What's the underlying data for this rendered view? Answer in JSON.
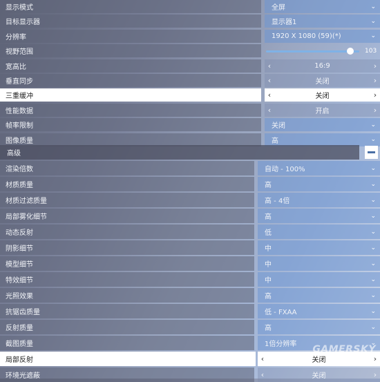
{
  "basic": [
    {
      "label": "显示模式",
      "value": "全屏",
      "kind": "dropdown"
    },
    {
      "label": "目标显示器",
      "value": "显示器1",
      "kind": "dropdown"
    },
    {
      "label": "分辨率",
      "value": "1920 X 1080 (59)(*)",
      "kind": "dropdown"
    },
    {
      "label": "视野范围",
      "value": "103",
      "kind": "slider",
      "level": 0.9
    },
    {
      "label": "宽高比",
      "value": "16:9",
      "kind": "carousel"
    },
    {
      "label": "垂直同步",
      "value": "关闭",
      "kind": "carousel"
    },
    {
      "label": "三重缓冲",
      "value": "关闭",
      "kind": "carousel",
      "selected": true
    },
    {
      "label": "性能数据",
      "value": "开启",
      "kind": "carousel"
    },
    {
      "label": "帧率限制",
      "value": "关闭",
      "kind": "dropdown"
    },
    {
      "label": "图像质量",
      "value": "高",
      "kind": "dropdown"
    }
  ],
  "advanced": {
    "title": "高级",
    "items": [
      {
        "label": "渲染倍数",
        "value": "自动 - 100%",
        "kind": "dropdown"
      },
      {
        "label": "材质质量",
        "value": "高",
        "kind": "dropdown"
      },
      {
        "label": "材质过滤质量",
        "value": "高 - 4倍",
        "kind": "dropdown"
      },
      {
        "label": "局部雾化细节",
        "value": "高",
        "kind": "dropdown"
      },
      {
        "label": "动态反射",
        "value": "低",
        "kind": "dropdown"
      },
      {
        "label": "阴影细节",
        "value": "中",
        "kind": "dropdown"
      },
      {
        "label": "模型细节",
        "value": "中",
        "kind": "dropdown"
      },
      {
        "label": "特效细节",
        "value": "中",
        "kind": "dropdown"
      },
      {
        "label": "光照效果",
        "value": "高",
        "kind": "dropdown"
      },
      {
        "label": "抗锯齿质量",
        "value": "低 - FXAA",
        "kind": "dropdown"
      },
      {
        "label": "反射质量",
        "value": "高",
        "kind": "dropdown"
      },
      {
        "label": "截图质量",
        "value": "1倍分辨率",
        "kind": "dropdown"
      },
      {
        "label": "局部反射",
        "value": "关闭",
        "kind": "carousel",
        "selected": true
      },
      {
        "label": "环境光遮蔽",
        "value": "关闭",
        "kind": "carousel"
      }
    ]
  },
  "watermark": "GAMERSKY",
  "icons": {
    "dropdown": "chevron-down-icon",
    "prev": "chevron-left-icon",
    "next": "chevron-right-icon",
    "collapse": "minus-icon"
  }
}
